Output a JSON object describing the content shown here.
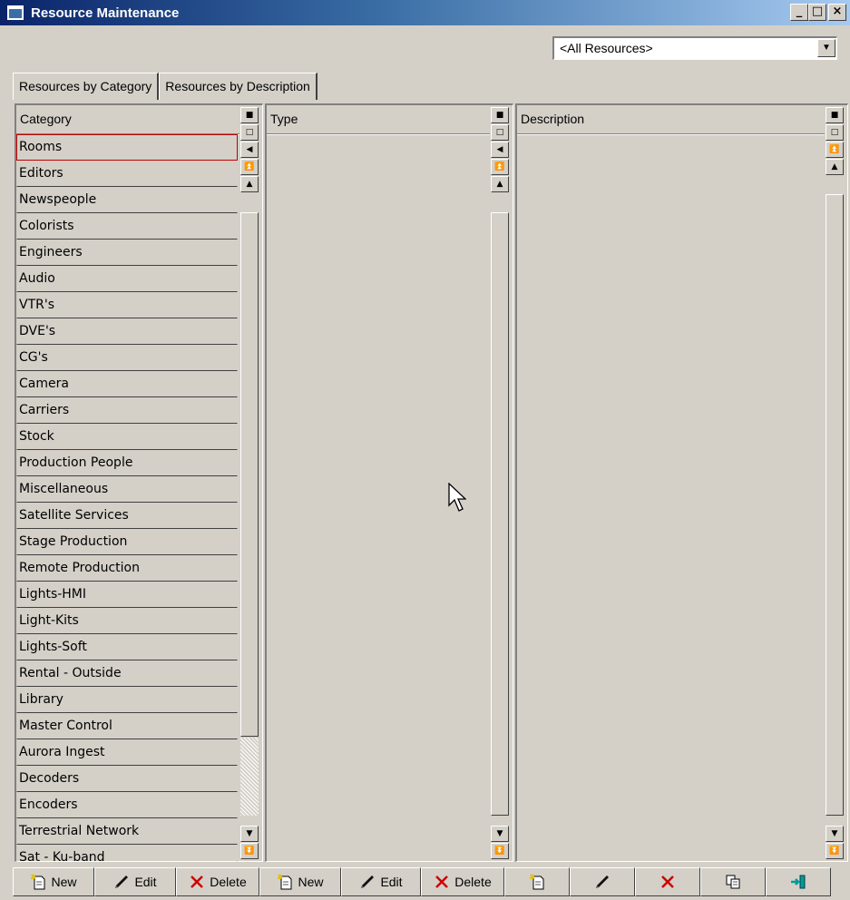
{
  "window": {
    "title": "Resource Maintenance",
    "minimize": "_",
    "maximize": "□",
    "close": "×"
  },
  "filter": {
    "selected": "<All Resources>"
  },
  "tabs": [
    {
      "label": "Resources by Category",
      "active": true
    },
    {
      "label": "Resources by Description",
      "active": false
    }
  ],
  "panels": {
    "category": {
      "header": "Category",
      "items": [
        "Rooms",
        "Editors",
        "Newspeople",
        "Colorists",
        "Engineers",
        "Audio",
        "VTR's",
        "DVE's",
        "CG's",
        "Camera",
        "Carriers",
        "Stock",
        "Production People",
        "Miscellaneous",
        "Satellite Services",
        "Stage Production",
        "Remote Production",
        "Lights-HMI",
        "Light-Kits",
        "Lights-Soft",
        "Rental - Outside",
        "Library",
        "Master Control",
        "Aurora Ingest",
        "Decoders",
        "Encoders",
        "Terrestrial Network",
        "Sat - Ku-band"
      ]
    },
    "type": {
      "header": "Type",
      "items": []
    },
    "description": {
      "header": "Description",
      "items": []
    }
  },
  "toolbar": {
    "category_new": "New",
    "category_edit": "Edit",
    "category_delete": "Delete",
    "type_new": "New",
    "type_edit": "Edit",
    "type_delete": "Delete"
  },
  "icons": {
    "new": "new-document-icon",
    "edit": "pencil-icon",
    "delete": "delete-x-icon",
    "copy": "copy-icon",
    "exit": "exit-door-icon"
  },
  "colors": {
    "title_start": "#0a246a",
    "title_end": "#a6caf0",
    "face": "#d4d0c8",
    "selection_border": "#c00000",
    "delete_red": "#cc0000"
  }
}
